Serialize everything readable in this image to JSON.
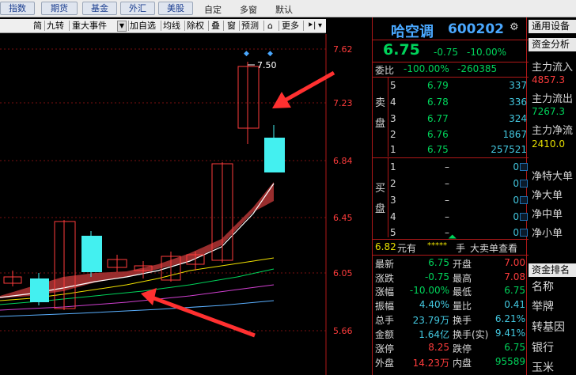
{
  "top_tabs": {
    "market": [
      "指数",
      "期货",
      "基金",
      "外汇",
      "美股"
    ],
    "sub": [
      "自定",
      "多窗",
      "默认"
    ]
  },
  "chart_toolbar": {
    "items": [
      "简",
      "九转",
      "重大事件",
      "加自选",
      "均线",
      "除权",
      "叠",
      "窗",
      "预测",
      "更多"
    ]
  },
  "chart": {
    "price_axis": [
      "7.62",
      "7.23",
      "6.84",
      "6.45",
      "6.05",
      "5.66"
    ],
    "high_label": "7.50",
    "colors": {
      "up": "#ff3c3c",
      "down": "#43f0f0",
      "band": "#a83232"
    }
  },
  "quote": {
    "name": "哈空调",
    "code": "600202",
    "price": "6.75",
    "change": "-0.75",
    "pct": "-10.00%",
    "webi_label": "委比",
    "webi_pct": "-100.00%",
    "webi_val": "-260385",
    "sell_side_label": "卖盘",
    "buy_side_label": "买盘",
    "sells": [
      {
        "lvl": "5",
        "price": "6.79",
        "vol": "337"
      },
      {
        "lvl": "4",
        "price": "6.78",
        "vol": "336"
      },
      {
        "lvl": "3",
        "price": "6.77",
        "vol": "324"
      },
      {
        "lvl": "2",
        "price": "6.76",
        "vol": "1867"
      },
      {
        "lvl": "1",
        "price": "6.75",
        "vol": "257521"
      }
    ],
    "buys": [
      {
        "lvl": "1",
        "price": "–",
        "vol": "0"
      },
      {
        "lvl": "2",
        "price": "–",
        "vol": "0"
      },
      {
        "lvl": "3",
        "price": "–",
        "vol": "0"
      },
      {
        "lvl": "4",
        "price": "–",
        "vol": "0"
      },
      {
        "lvl": "5",
        "price": "–",
        "vol": "0"
      }
    ],
    "order_row": {
      "price": "6.82",
      "unit": "元有",
      "stars": "*****",
      "hand": "手",
      "action": "大卖单查看"
    },
    "stats": [
      {
        "l1": "最新",
        "v1": "6.75",
        "l2": "开盘",
        "v2": "7.00"
      },
      {
        "l1": "涨跌",
        "v1": "-0.75",
        "l2": "最高",
        "v2": "7.08"
      },
      {
        "l1": "涨幅",
        "v1": "-10.00%",
        "l2": "最低",
        "v2": "6.75"
      },
      {
        "l1": "振幅",
        "v1": "4.40%",
        "l2": "量比",
        "v2": "0.41"
      },
      {
        "l1": "总手",
        "v1": "23.79万",
        "l2": "换手",
        "v2": "6.21%"
      },
      {
        "l1": "金额",
        "v1": "1.64亿",
        "l2": "换手(实)",
        "v2": "9.41%"
      },
      {
        "l1": "涨停",
        "v1": "8.25",
        "l2": "跌停",
        "v2": "6.75"
      },
      {
        "l1": "外盘",
        "v1": "14.23万",
        "l2": "内盘",
        "v2": "95589"
      }
    ]
  },
  "side": {
    "header": "通用设备",
    "fund_title": "资金分析",
    "flows": [
      {
        "label": "主力流入",
        "value": "4857.3"
      },
      {
        "label": "主力流出",
        "value": "7267.3"
      },
      {
        "label": "主力净流",
        "value": "2410.0"
      }
    ],
    "net_items": [
      "净特大单",
      "净大单",
      "净中单",
      "净小单"
    ],
    "rank_title": "资金排名",
    "rank_header": "名称",
    "rank_items": [
      "举牌",
      "转基因",
      "银行",
      "玉米"
    ]
  }
}
